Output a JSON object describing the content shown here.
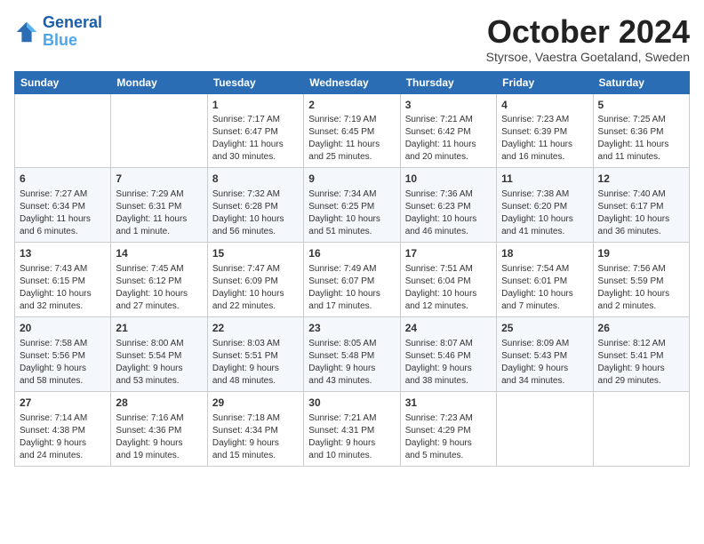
{
  "header": {
    "logo_line1": "General",
    "logo_line2": "Blue",
    "month": "October 2024",
    "location": "Styrsoe, Vaestra Goetaland, Sweden"
  },
  "days_of_week": [
    "Sunday",
    "Monday",
    "Tuesday",
    "Wednesday",
    "Thursday",
    "Friday",
    "Saturday"
  ],
  "weeks": [
    [
      {
        "day": "",
        "info": ""
      },
      {
        "day": "",
        "info": ""
      },
      {
        "day": "1",
        "info": "Sunrise: 7:17 AM\nSunset: 6:47 PM\nDaylight: 11 hours\nand 30 minutes."
      },
      {
        "day": "2",
        "info": "Sunrise: 7:19 AM\nSunset: 6:45 PM\nDaylight: 11 hours\nand 25 minutes."
      },
      {
        "day": "3",
        "info": "Sunrise: 7:21 AM\nSunset: 6:42 PM\nDaylight: 11 hours\nand 20 minutes."
      },
      {
        "day": "4",
        "info": "Sunrise: 7:23 AM\nSunset: 6:39 PM\nDaylight: 11 hours\nand 16 minutes."
      },
      {
        "day": "5",
        "info": "Sunrise: 7:25 AM\nSunset: 6:36 PM\nDaylight: 11 hours\nand 11 minutes."
      }
    ],
    [
      {
        "day": "6",
        "info": "Sunrise: 7:27 AM\nSunset: 6:34 PM\nDaylight: 11 hours\nand 6 minutes."
      },
      {
        "day": "7",
        "info": "Sunrise: 7:29 AM\nSunset: 6:31 PM\nDaylight: 11 hours\nand 1 minute."
      },
      {
        "day": "8",
        "info": "Sunrise: 7:32 AM\nSunset: 6:28 PM\nDaylight: 10 hours\nand 56 minutes."
      },
      {
        "day": "9",
        "info": "Sunrise: 7:34 AM\nSunset: 6:25 PM\nDaylight: 10 hours\nand 51 minutes."
      },
      {
        "day": "10",
        "info": "Sunrise: 7:36 AM\nSunset: 6:23 PM\nDaylight: 10 hours\nand 46 minutes."
      },
      {
        "day": "11",
        "info": "Sunrise: 7:38 AM\nSunset: 6:20 PM\nDaylight: 10 hours\nand 41 minutes."
      },
      {
        "day": "12",
        "info": "Sunrise: 7:40 AM\nSunset: 6:17 PM\nDaylight: 10 hours\nand 36 minutes."
      }
    ],
    [
      {
        "day": "13",
        "info": "Sunrise: 7:43 AM\nSunset: 6:15 PM\nDaylight: 10 hours\nand 32 minutes."
      },
      {
        "day": "14",
        "info": "Sunrise: 7:45 AM\nSunset: 6:12 PM\nDaylight: 10 hours\nand 27 minutes."
      },
      {
        "day": "15",
        "info": "Sunrise: 7:47 AM\nSunset: 6:09 PM\nDaylight: 10 hours\nand 22 minutes."
      },
      {
        "day": "16",
        "info": "Sunrise: 7:49 AM\nSunset: 6:07 PM\nDaylight: 10 hours\nand 17 minutes."
      },
      {
        "day": "17",
        "info": "Sunrise: 7:51 AM\nSunset: 6:04 PM\nDaylight: 10 hours\nand 12 minutes."
      },
      {
        "day": "18",
        "info": "Sunrise: 7:54 AM\nSunset: 6:01 PM\nDaylight: 10 hours\nand 7 minutes."
      },
      {
        "day": "19",
        "info": "Sunrise: 7:56 AM\nSunset: 5:59 PM\nDaylight: 10 hours\nand 2 minutes."
      }
    ],
    [
      {
        "day": "20",
        "info": "Sunrise: 7:58 AM\nSunset: 5:56 PM\nDaylight: 9 hours\nand 58 minutes."
      },
      {
        "day": "21",
        "info": "Sunrise: 8:00 AM\nSunset: 5:54 PM\nDaylight: 9 hours\nand 53 minutes."
      },
      {
        "day": "22",
        "info": "Sunrise: 8:03 AM\nSunset: 5:51 PM\nDaylight: 9 hours\nand 48 minutes."
      },
      {
        "day": "23",
        "info": "Sunrise: 8:05 AM\nSunset: 5:48 PM\nDaylight: 9 hours\nand 43 minutes."
      },
      {
        "day": "24",
        "info": "Sunrise: 8:07 AM\nSunset: 5:46 PM\nDaylight: 9 hours\nand 38 minutes."
      },
      {
        "day": "25",
        "info": "Sunrise: 8:09 AM\nSunset: 5:43 PM\nDaylight: 9 hours\nand 34 minutes."
      },
      {
        "day": "26",
        "info": "Sunrise: 8:12 AM\nSunset: 5:41 PM\nDaylight: 9 hours\nand 29 minutes."
      }
    ],
    [
      {
        "day": "27",
        "info": "Sunrise: 7:14 AM\nSunset: 4:38 PM\nDaylight: 9 hours\nand 24 minutes."
      },
      {
        "day": "28",
        "info": "Sunrise: 7:16 AM\nSunset: 4:36 PM\nDaylight: 9 hours\nand 19 minutes."
      },
      {
        "day": "29",
        "info": "Sunrise: 7:18 AM\nSunset: 4:34 PM\nDaylight: 9 hours\nand 15 minutes."
      },
      {
        "day": "30",
        "info": "Sunrise: 7:21 AM\nSunset: 4:31 PM\nDaylight: 9 hours\nand 10 minutes."
      },
      {
        "day": "31",
        "info": "Sunrise: 7:23 AM\nSunset: 4:29 PM\nDaylight: 9 hours\nand 5 minutes."
      },
      {
        "day": "",
        "info": ""
      },
      {
        "day": "",
        "info": ""
      }
    ]
  ]
}
